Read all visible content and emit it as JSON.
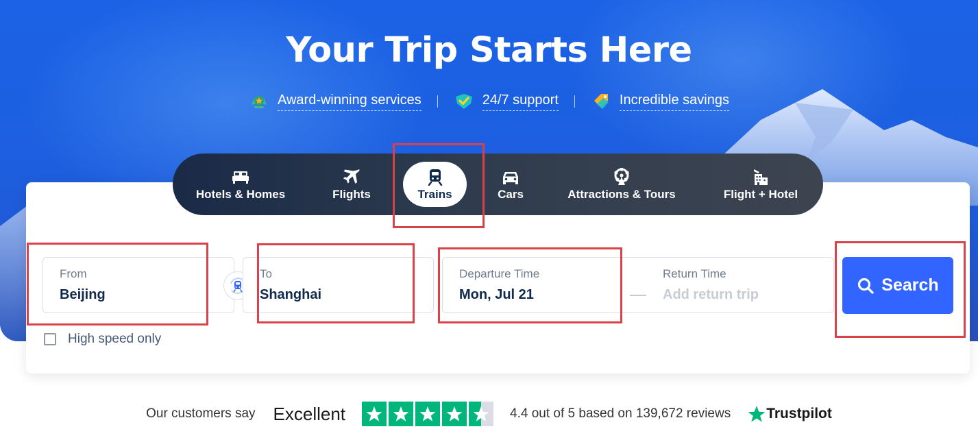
{
  "hero": {
    "title": "Your Trip Starts Here",
    "benefits": [
      {
        "icon": "award-icon",
        "label": "Award-winning services"
      },
      {
        "icon": "support-icon",
        "label": "24/7 support"
      },
      {
        "icon": "tag-icon",
        "label": "Incredible savings"
      }
    ]
  },
  "tabs": [
    {
      "icon": "bed-icon",
      "label": "Hotels & Homes"
    },
    {
      "icon": "plane-icon",
      "label": "Flights"
    },
    {
      "icon": "train-icon",
      "label": "Trains",
      "active": true
    },
    {
      "icon": "car-icon",
      "label": "Cars"
    },
    {
      "icon": "ferris-wheel-icon",
      "label": "Attractions & Tours"
    },
    {
      "icon": "flight-hotel-icon",
      "label": "Flight + Hotel"
    }
  ],
  "search": {
    "from": {
      "label": "From",
      "value": "Beijing"
    },
    "to": {
      "label": "To",
      "value": "Shanghai"
    },
    "departure": {
      "label": "Departure Time",
      "value": "Mon, Jul 21"
    },
    "return": {
      "label": "Return Time",
      "placeholder": "Add return trip"
    },
    "high_speed_label": "High speed only",
    "high_speed_checked": false,
    "button_label": "Search"
  },
  "trustpilot": {
    "intro": "Our customers say",
    "rating_word": "Excellent",
    "stars": 4.5,
    "summary": "4.4 out of 5 based on 139,672 reviews",
    "brand": "Trustpilot"
  },
  "colors": {
    "hero_blue": "#1d5fe0",
    "accent_blue": "#3264ff",
    "dark_text": "#0f294d",
    "highlight_red": "#d9424b",
    "trustpilot_green": "#00b67a"
  }
}
